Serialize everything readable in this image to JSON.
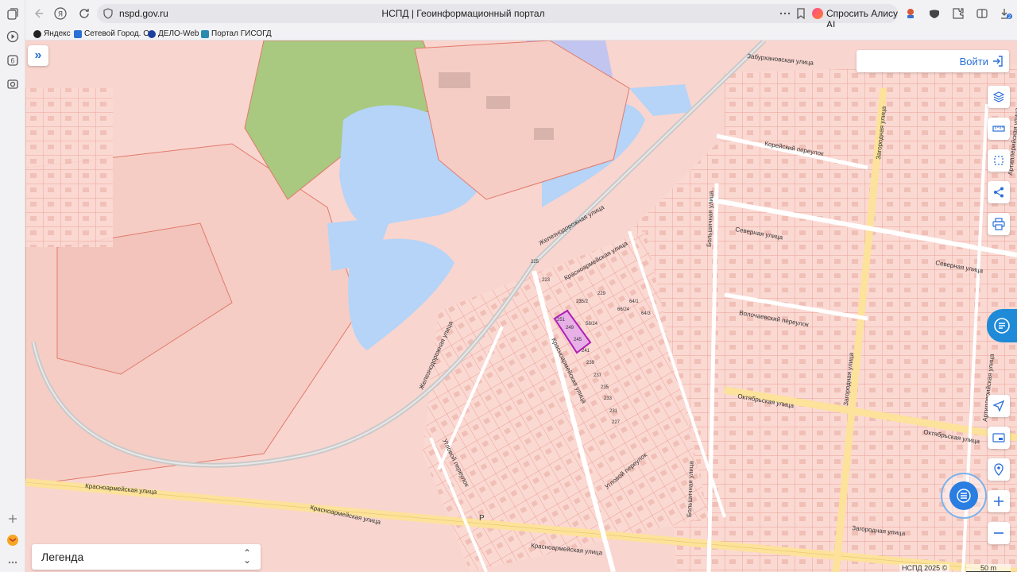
{
  "browser": {
    "url": "nspd.gov.ru",
    "title": "НСПД | Геоинформационный портал",
    "alice_label": "Спросить Алису AI",
    "notification_count": "2",
    "bookmarks": [
      {
        "label": "Яндекс",
        "icon": "yandex-icon",
        "color": "#222222"
      },
      {
        "label": "Сетевой Город. О",
        "icon": "network-city-icon",
        "color": "#2a6fd6"
      },
      {
        "label": "ДЕЛО-Web",
        "icon": "delo-icon",
        "color": "#1c3f9e"
      },
      {
        "label": "Портал ГИСОГД",
        "icon": "gisogd-icon",
        "color": "#2a8ab0"
      }
    ]
  },
  "map": {
    "login_label": "Войти",
    "legend_label": "Легенда",
    "copyright": "НСПД 2025 ©",
    "scale_label": "50 m",
    "colors": {
      "parcel_fill": "#f9d5cf",
      "parcel_line": "#e07a6c",
      "water": "#b5d4f7",
      "forest": "#a8c97f",
      "road": "#fce29a",
      "selected": "#b01fb5"
    },
    "streets": [
      "Забурхановская улица",
      "Корейский переулок",
      "Северная улица",
      "Северная улица",
      "Волочаевский переулок",
      "Октябрьская улица",
      "Октябрьская улица",
      "Загородная улица",
      "Загородная улица",
      "Загородная улица",
      "Большичная улица",
      "Большичная улица",
      "Железнодорожная улица",
      "Железнодорожная улица",
      "Красноармейская улица",
      "Красноармейская улица",
      "Красноармейская улица",
      "Красноармейская улица",
      "Красноармейская улица",
      "Угловой переулок",
      "Угловой переулок",
      "Артиллерийская улица",
      "Артиллерийская улица"
    ],
    "parcel_numbers": [
      "251",
      "249",
      "245",
      "241",
      "239",
      "237",
      "235",
      "233",
      "231",
      "227",
      "64/1",
      "64/3",
      "58/24",
      "66/24",
      "235/2",
      "229",
      "223",
      "225"
    ],
    "tools": [
      {
        "name": "layers-icon"
      },
      {
        "name": "ruler-icon"
      },
      {
        "name": "select-area-icon"
      },
      {
        "name": "share-icon"
      },
      {
        "name": "print-icon"
      },
      {
        "name": "locate-icon"
      },
      {
        "name": "minimap-icon"
      },
      {
        "name": "pin-icon"
      },
      {
        "name": "zoom-in-icon"
      },
      {
        "name": "zoom-out-icon"
      }
    ]
  }
}
